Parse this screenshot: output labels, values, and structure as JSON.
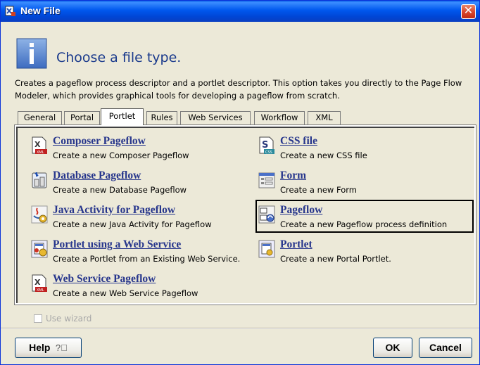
{
  "window": {
    "title": "New File"
  },
  "header": {
    "heading": "Choose a file type.",
    "description": "Creates a pageflow process descriptor and a portlet descriptor. This option takes you directly to the Page Flow Modeler, which provides graphical tools for developing a pageflow from scratch."
  },
  "tabs": [
    {
      "label": "General"
    },
    {
      "label": "Portal"
    },
    {
      "label": "Portlet",
      "active": true
    },
    {
      "label": "Rules"
    },
    {
      "label": "Web Services"
    },
    {
      "label": "Workflow"
    },
    {
      "label": "XML"
    }
  ],
  "items": [
    {
      "name": "Composer Pageflow",
      "desc": "Create a new Composer Pageflow",
      "icon": "xml-file-icon"
    },
    {
      "name": "Database Pageflow",
      "desc": "Create a new Database Pageflow",
      "icon": "database-icon"
    },
    {
      "name": "Java Activity for Pageflow",
      "desc": "Create a new Java Activity for Pageflow",
      "icon": "java-icon"
    },
    {
      "name": "Portlet using a Web Service",
      "desc": "Create a Portlet from an Existing Web Service.",
      "icon": "portlet-webservice-icon"
    },
    {
      "name": "Web Service Pageflow",
      "desc": "Create a new Web Service Pageflow",
      "icon": "xml-file-icon"
    },
    {
      "name": "CSS file",
      "desc": "Create a new CSS file",
      "icon": "css-file-icon"
    },
    {
      "name": "Form",
      "desc": "Create a new Form",
      "icon": "form-icon"
    },
    {
      "name": "Pageflow",
      "desc": "Create a new Pageflow process definition",
      "icon": "pageflow-icon",
      "selected": true
    },
    {
      "name": "Portlet",
      "desc": "Create a new Portal Portlet.",
      "icon": "portlet-icon"
    }
  ],
  "options": {
    "use_wizard": "Use wizard",
    "use_wizard_checked": false
  },
  "buttons": {
    "help": "Help",
    "ok": "OK",
    "cancel": "Cancel"
  }
}
